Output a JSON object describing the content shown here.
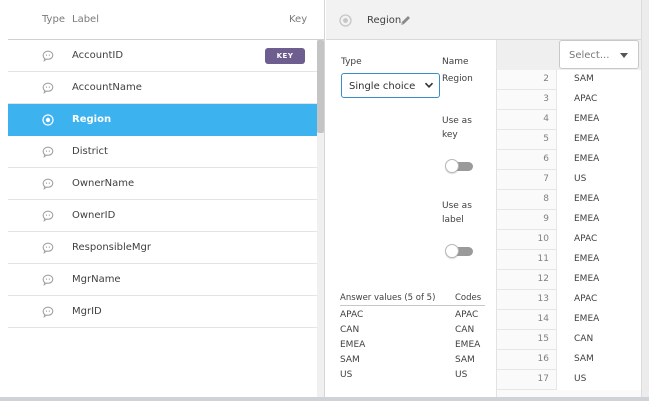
{
  "list": {
    "headers": {
      "type": "Type",
      "label": "Label",
      "key": "Key"
    },
    "key_badge": "KEY",
    "items": [
      {
        "label": "AccountID",
        "icon": "speech-bubble-icon",
        "is_key": true,
        "selected": false
      },
      {
        "label": "AccountName",
        "icon": "speech-bubble-icon",
        "is_key": false,
        "selected": false
      },
      {
        "label": "Region",
        "icon": "radio-icon",
        "is_key": false,
        "selected": true
      },
      {
        "label": "District",
        "icon": "speech-bubble-icon",
        "is_key": false,
        "selected": false
      },
      {
        "label": "OwnerName",
        "icon": "speech-bubble-icon",
        "is_key": false,
        "selected": false
      },
      {
        "label": "OwnerID",
        "icon": "speech-bubble-icon",
        "is_key": false,
        "selected": false
      },
      {
        "label": "ResponsibleMgr",
        "icon": "speech-bubble-icon",
        "is_key": false,
        "selected": false
      },
      {
        "label": "MgrName",
        "icon": "speech-bubble-icon",
        "is_key": false,
        "selected": false
      },
      {
        "label": "MgrID",
        "icon": "speech-bubble-icon",
        "is_key": false,
        "selected": false
      }
    ]
  },
  "header": {
    "title": "Region",
    "icon": "radio-icon",
    "edit_icon": "pencil-icon"
  },
  "panel": {
    "type_label": "Type",
    "type_value": "Single choice",
    "name_label": "Name",
    "name_value": "Region",
    "use_as_key_line1": "Use as",
    "use_as_key_line2": "key",
    "use_as_key_on": false,
    "use_as_label_line1": "Use as",
    "use_as_label_line2": "label",
    "use_as_label_on": false,
    "answers_header": "Answer values (5 of 5)",
    "codes_header": "Codes",
    "answers": [
      {
        "value": "APAC",
        "code": "APAC"
      },
      {
        "value": "CAN",
        "code": "CAN"
      },
      {
        "value": "EMEA",
        "code": "EMEA"
      },
      {
        "value": "SAM",
        "code": "SAM"
      },
      {
        "value": "US",
        "code": "US"
      }
    ]
  },
  "grid": {
    "select_placeholder": "Select...",
    "rows": [
      {
        "num": "2",
        "value": "SAM"
      },
      {
        "num": "3",
        "value": "APAC"
      },
      {
        "num": "4",
        "value": "EMEA"
      },
      {
        "num": "5",
        "value": "EMEA"
      },
      {
        "num": "6",
        "value": "EMEA"
      },
      {
        "num": "7",
        "value": "US"
      },
      {
        "num": "8",
        "value": "EMEA"
      },
      {
        "num": "9",
        "value": "EMEA"
      },
      {
        "num": "10",
        "value": "APAC"
      },
      {
        "num": "11",
        "value": "EMEA"
      },
      {
        "num": "12",
        "value": "EMEA"
      },
      {
        "num": "13",
        "value": "APAC"
      },
      {
        "num": "14",
        "value": "EMEA"
      },
      {
        "num": "15",
        "value": "CAN"
      },
      {
        "num": "16",
        "value": "SAM"
      },
      {
        "num": "17",
        "value": "US"
      }
    ]
  },
  "colors": {
    "selected_row": "#3cb2ee",
    "key_badge": "#6e5d8f",
    "select_border": "#3a8cc9"
  }
}
